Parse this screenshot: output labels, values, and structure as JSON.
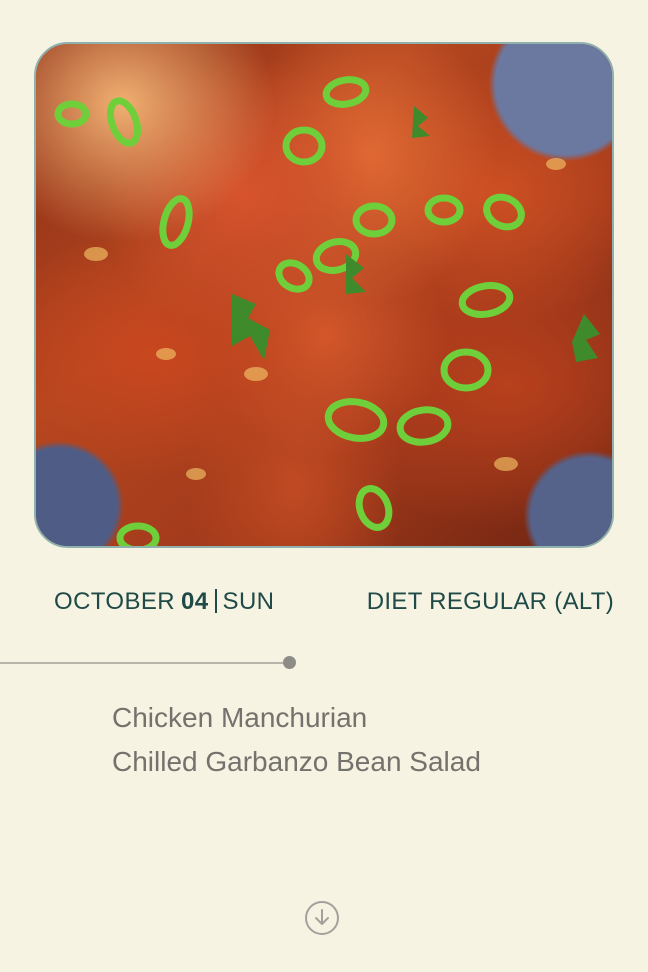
{
  "meal": {
    "image_alt": "Chicken Manchurian",
    "month": "OCTOBER",
    "day": "04",
    "weekday": "SUN",
    "diet": "DIET REGULAR (ALT)"
  },
  "menu": {
    "items": [
      "Chicken Manchurian",
      "Chilled Garbanzo Bean Salad"
    ]
  },
  "icons": {
    "scroll": "arrow-down-circle-icon"
  },
  "colors": {
    "background": "#f6f3e2",
    "accent_text": "#1f4a47",
    "menu_text": "#74726d",
    "image_border": "#8fb1ae"
  }
}
